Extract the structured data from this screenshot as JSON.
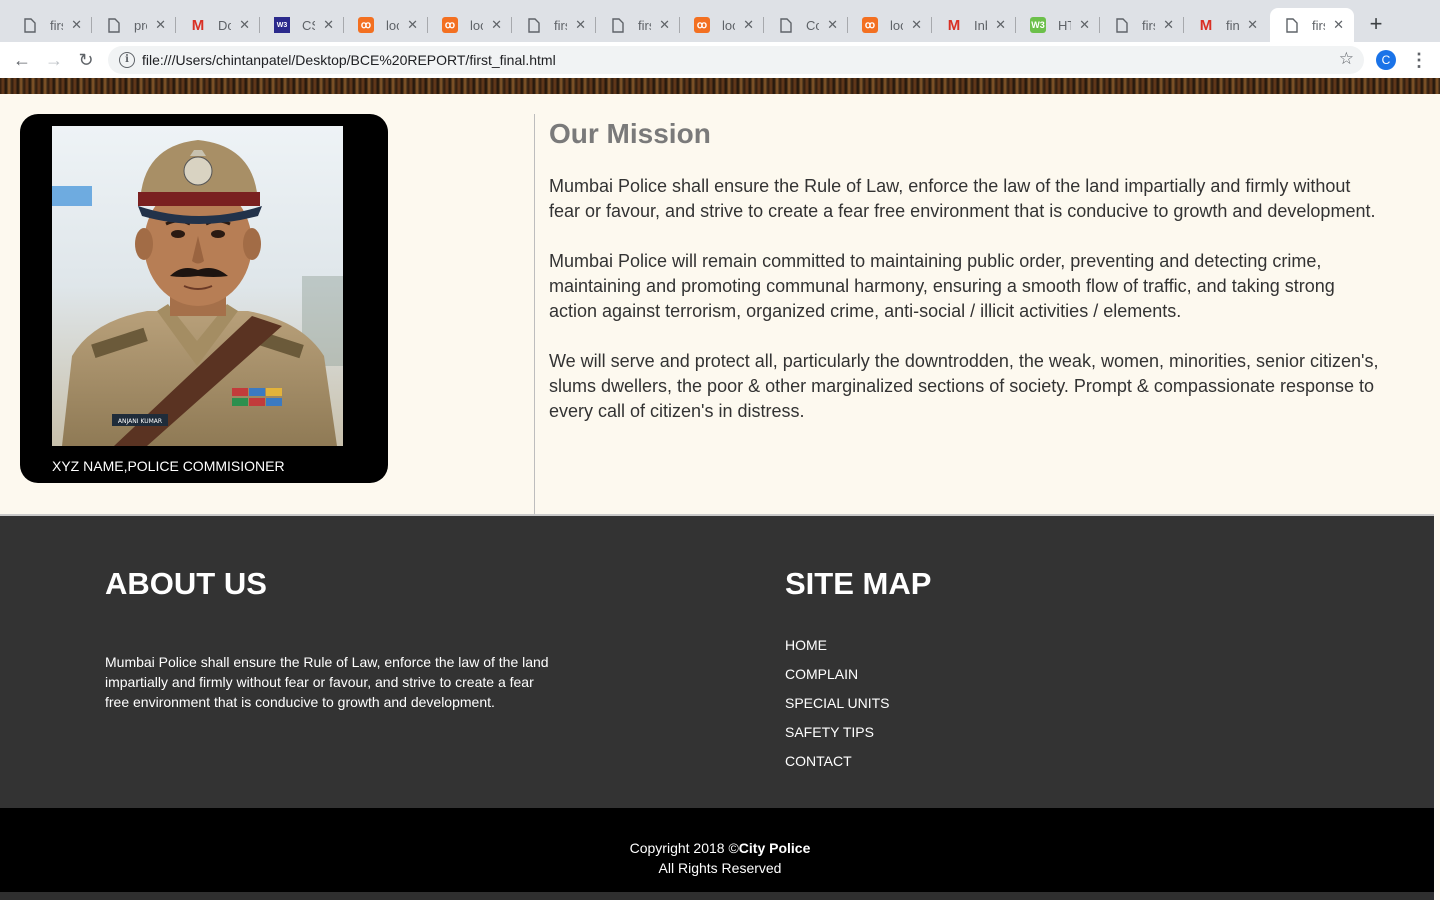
{
  "browser": {
    "tabs": [
      {
        "label": "first_final.html",
        "icon": "file-icon"
      },
      {
        "label": "project",
        "icon": "file-icon"
      },
      {
        "label": "Docs",
        "icon": "gmail-icon"
      },
      {
        "label": "CSS",
        "icon": "w3schools-icon"
      },
      {
        "label": "localhost",
        "icon": "xampp-icon"
      },
      {
        "label": "localhost",
        "icon": "xampp-icon"
      },
      {
        "label": "first",
        "icon": "file-icon"
      },
      {
        "label": "first",
        "icon": "file-icon"
      },
      {
        "label": "localhost",
        "icon": "xampp-icon"
      },
      {
        "label": "Con",
        "icon": "file-icon"
      },
      {
        "label": "localhost",
        "icon": "xampp-icon"
      },
      {
        "label": "Inbox",
        "icon": "gmail-icon"
      },
      {
        "label": "HTML",
        "icon": "html-icon"
      },
      {
        "label": "first",
        "icon": "file-icon"
      },
      {
        "label": "final",
        "icon": "gmail-icon"
      },
      {
        "label": "first",
        "icon": "file-icon"
      }
    ],
    "url": "file:///Users/chintanpatel/Desktop/BCE%20REPORT/first_final.html",
    "profile_initial": "C"
  },
  "officer": {
    "caption": "XYZ NAME,POLICE COMMISIONER",
    "badge_name": "ANJANI KUMAR"
  },
  "mission": {
    "title": "Our Mission",
    "paragraphs": [
      "Mumbai Police shall ensure the Rule of Law, enforce the law of the land impartially and firmly without fear or favour, and strive to create a fear free environment that is conducive to growth and development.",
      "Mumbai Police will remain committed to maintaining public order, preventing and detecting crime, maintaining and promoting communal harmony, ensuring a smooth flow of traffic, and taking strong action against terrorism, organized crime, anti-social / illicit activities / elements.",
      "We will serve and protect all, particularly the downtrodden, the weak, women, minorities, senior citizen's, slums dwellers, the poor & other marginalized sections of society. Prompt & compassionate response to every call of citizen's in distress."
    ]
  },
  "footer": {
    "about_title": "ABOUT US",
    "about_text": "Mumbai Police shall ensure the Rule of Law, enforce the law of the land impartially and firmly without fear or favour, and strive to create a fear free environment that is conducive to growth and development.",
    "sitemap_title": "SITE MAP",
    "sitemap_links": [
      "HOME",
      "COMPLAIN",
      "SPECIAL UNITS",
      "SAFETY TIPS",
      "CONTACT"
    ],
    "copyright_prefix": "Copyright 2018 ©",
    "copyright_brand": "City Police",
    "rights": "All Rights Reserved"
  }
}
